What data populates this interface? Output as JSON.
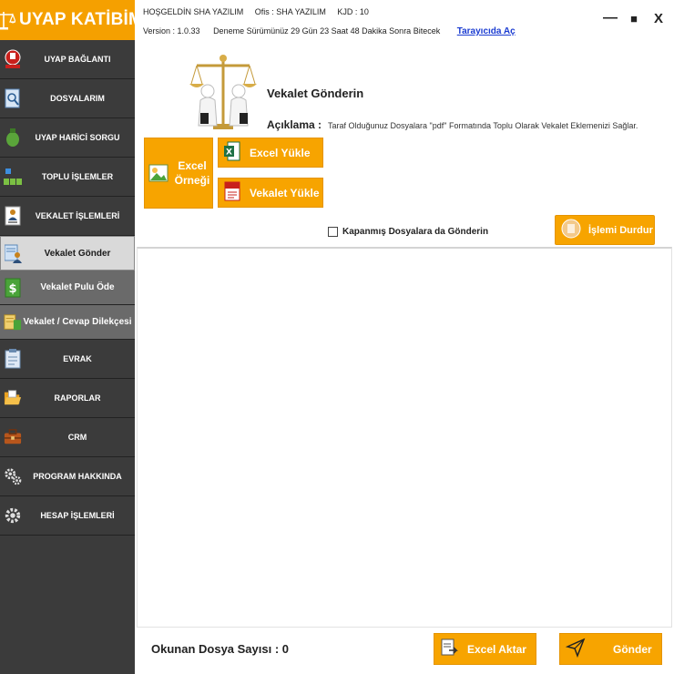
{
  "app": {
    "logo_text": "UYAP KATİBİM",
    "welcome": "HOŞGELDİN SHA YAZILIM",
    "office": "Ofis : SHA YAZILIM",
    "kid": "KJD : 10",
    "version": "Version : 1.0.33",
    "trial": "Deneme Sürümünüz 29 Gün 23 Saat 48 Dakika Sonra Bitecek",
    "browser_link": "Tarayıcıda Aç",
    "minimize_glyph": "—",
    "maximize_glyph": "■",
    "close_glyph": "X"
  },
  "colors": {
    "accent": "#f7a400",
    "sidebar": "#3b3b3b",
    "sidebar_sub": "#6a6a6a",
    "sidebar_active": "#d9d9d9",
    "link": "#1a3bd1"
  },
  "sidebar": {
    "items": [
      {
        "label": "UYAP BAĞLANTI",
        "icon": "uyap-logo-icon"
      },
      {
        "label": "DOSYALARIM",
        "icon": "folder-search-icon"
      },
      {
        "label": "UYAP HARİCİ SORGU",
        "icon": "bottle-icon"
      },
      {
        "label": "TOPLU İŞLEMLER",
        "icon": "blocks-icon"
      },
      {
        "label": "VEKALET İŞLEMLERİ",
        "icon": "person-document-icon"
      },
      {
        "label": "Vekalet Gönder",
        "icon": "send-document-icon",
        "active": true
      },
      {
        "label": "Vekalet Pulu Öde",
        "icon": "money-icon"
      },
      {
        "label": "Vekalet / Cevap Dilekçesi",
        "icon": "petition-icon"
      },
      {
        "label": "EVRAK",
        "icon": "clipboard-icon"
      },
      {
        "label": "RAPORLAR",
        "icon": "open-folder-icon"
      },
      {
        "label": "CRM",
        "icon": "briefcase-icon"
      },
      {
        "label": "PROGRAM HAKKINDA",
        "icon": "gears-icon"
      },
      {
        "label": "HESAP İŞLEMLERİ",
        "icon": "gear-icon"
      }
    ]
  },
  "main": {
    "title": "Vekalet Gönderin",
    "description_label": "Açıklama :",
    "description": "Taraf Olduğunuz Dosyalara \"pdf\" Formatında Toplu Olarak Vekalet Eklemenizi Sağlar.",
    "excel_sample_line1": "Excel",
    "excel_sample_line2": "Örneği",
    "excel_upload": "Excel Yükle",
    "vekalet_upload": "Vekalet Yükle",
    "closed_files_checkbox": "Kapanmış Dosyalara da Gönderin",
    "closed_files_checked": false,
    "stop_button": "İşlemi Durdur"
  },
  "footer": {
    "count_label": "Okunan Dosya Sayısı : 0",
    "excel_export": "Excel Aktar",
    "send": "Gönder"
  }
}
